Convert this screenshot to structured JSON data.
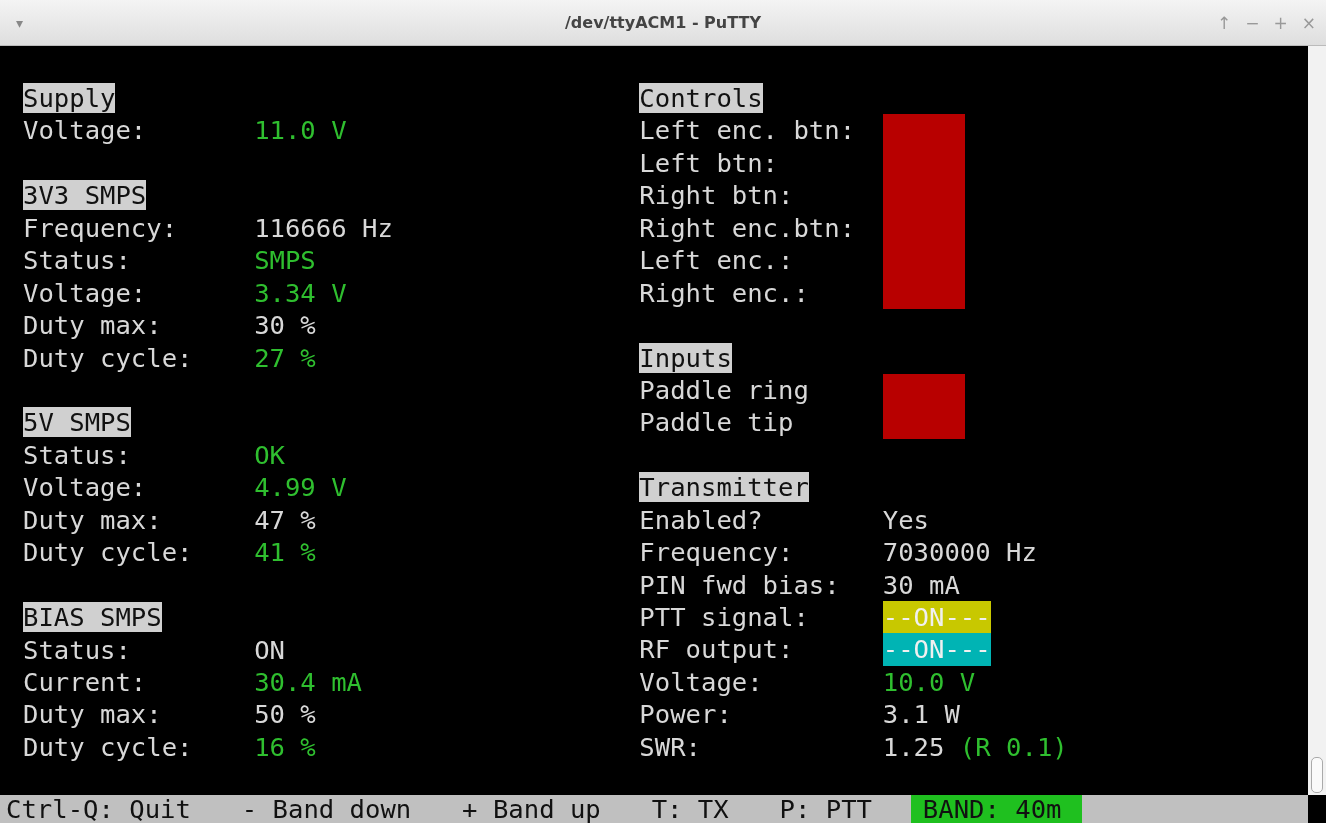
{
  "window": {
    "menu_glyph": "▾",
    "title": "/dev/ttyACM1 - PuTTY",
    "buttons": [
      "↑",
      "−",
      "+",
      "×"
    ]
  },
  "left_column": [
    {
      "title": "Supply",
      "rows": [
        {
          "label": "Voltage:",
          "values": [
            {
              "text": "11.0 V",
              "color": "#2fbf2f"
            }
          ]
        }
      ]
    },
    {
      "title": "3V3 SMPS",
      "rows": [
        {
          "label": "Frequency:",
          "values": [
            {
              "text": "116666 Hz",
              "color": "#d8d8d8"
            }
          ]
        },
        {
          "label": "Status:",
          "values": [
            {
              "text": "SMPS",
              "color": "#2fbf2f"
            }
          ]
        },
        {
          "label": "Voltage:",
          "values": [
            {
              "text": "3.34 V",
              "color": "#2fbf2f"
            }
          ]
        },
        {
          "label": "Duty max:",
          "values": [
            {
              "text": "30 %",
              "color": "#d8d8d8"
            }
          ]
        },
        {
          "label": "Duty cycle:",
          "values": [
            {
              "text": "27 %",
              "color": "#2fbf2f"
            }
          ]
        }
      ]
    },
    {
      "title": "5V SMPS",
      "rows": [
        {
          "label": "Status:",
          "values": [
            {
              "text": "OK",
              "color": "#2fbf2f"
            }
          ]
        },
        {
          "label": "Voltage:",
          "values": [
            {
              "text": "4.99 V",
              "color": "#2fbf2f"
            }
          ]
        },
        {
          "label": "Duty max:",
          "values": [
            {
              "text": "47 %",
              "color": "#d8d8d8"
            }
          ]
        },
        {
          "label": "Duty cycle:",
          "values": [
            {
              "text": "41 %",
              "color": "#2fbf2f"
            }
          ]
        }
      ]
    },
    {
      "title": "BIAS SMPS",
      "rows": [
        {
          "label": "Status:",
          "values": [
            {
              "text": "ON",
              "color": "#d8d8d8"
            }
          ]
        },
        {
          "label": "Current:",
          "values": [
            {
              "text": "30.4 mA",
              "color": "#2fbf2f"
            }
          ]
        },
        {
          "label": "Duty max:",
          "values": [
            {
              "text": "50 %",
              "color": "#d8d8d8"
            }
          ]
        },
        {
          "label": "Duty cycle:",
          "values": [
            {
              "text": "16 %",
              "color": "#2fbf2f"
            }
          ]
        }
      ]
    }
  ],
  "right_column": [
    {
      "title": "Controls",
      "rows": [
        {
          "label": "Left enc. btn:",
          "indicator": {
            "color": "#b80000"
          }
        },
        {
          "label": "Left btn:",
          "indicator": {
            "color": "#b80000"
          }
        },
        {
          "label": "Right btn:",
          "indicator": {
            "color": "#b80000"
          }
        },
        {
          "label": "Right enc.btn:",
          "indicator": {
            "color": "#b80000"
          }
        },
        {
          "label": "Left enc.:",
          "indicator": {
            "color": "#b80000"
          }
        },
        {
          "label": "Right enc.:",
          "indicator": {
            "color": "#b80000"
          }
        }
      ]
    },
    {
      "title": "Inputs",
      "rows": [
        {
          "label": "Paddle ring",
          "indicator": {
            "color": "#b80000"
          }
        },
        {
          "label": "Paddle tip",
          "indicator": {
            "color": "#b80000"
          }
        }
      ]
    },
    {
      "title": "Transmitter",
      "rows": [
        {
          "label": "Enabled?",
          "values": [
            {
              "text": "Yes",
              "color": "#d8d8d8"
            }
          ]
        },
        {
          "label": "Frequency:",
          "values": [
            {
              "text": "7030000 Hz",
              "color": "#d8d8d8"
            }
          ]
        },
        {
          "label": "PIN fwd bias:",
          "values": [
            {
              "text": "30 mA",
              "color": "#d8d8d8"
            }
          ]
        },
        {
          "label": "PTT signal:",
          "values": [
            {
              "text": "--ON---",
              "kind": "badge",
              "color": "#c8c800"
            }
          ]
        },
        {
          "label": "RF output:",
          "values": [
            {
              "text": "--ON---",
              "kind": "badge",
              "color": "#00b4b4"
            }
          ]
        },
        {
          "label": "Voltage:",
          "values": [
            {
              "text": "10.0 V",
              "color": "#2fbf2f"
            }
          ]
        },
        {
          "label": "Power:",
          "values": [
            {
              "text": "3.1 W",
              "color": "#d8d8d8"
            }
          ]
        },
        {
          "label": "SWR:",
          "values": [
            {
              "text": "1.25",
              "color": "#d8d8d8"
            },
            {
              "text": "(R 0.1)",
              "color": "#2fbf2f"
            }
          ]
        }
      ]
    }
  ],
  "status_bar": [
    {
      "text": "Ctrl-Q: Quit",
      "highlighted": false
    },
    {
      "text": "- Band down",
      "highlighted": false
    },
    {
      "text": "+ Band up",
      "highlighted": false
    },
    {
      "text": "T: TX",
      "highlighted": false
    },
    {
      "text": "P: PTT",
      "highlighted": false
    },
    {
      "text": "BAND: 40m",
      "highlighted": true
    }
  ]
}
